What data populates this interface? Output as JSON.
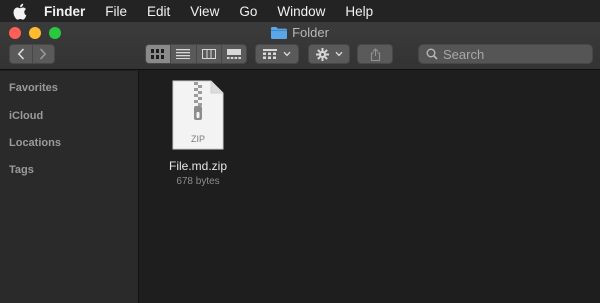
{
  "menubar": {
    "app": "Finder",
    "items": [
      "File",
      "Edit",
      "View",
      "Go",
      "Window",
      "Help"
    ]
  },
  "window": {
    "title": "Folder"
  },
  "toolbar": {
    "search_placeholder": "Search"
  },
  "sidebar": {
    "items": [
      {
        "label": "Favorites"
      },
      {
        "label": "iCloud"
      },
      {
        "label": "Locations"
      },
      {
        "label": "Tags"
      }
    ]
  },
  "files": [
    {
      "name": "File.md.zip",
      "size": "678 bytes",
      "badge": "ZIP"
    }
  ],
  "colors": {
    "close": "#fe5f57",
    "minimize": "#febc2e",
    "zoom": "#28c840",
    "folder": "#5aa6e6"
  }
}
